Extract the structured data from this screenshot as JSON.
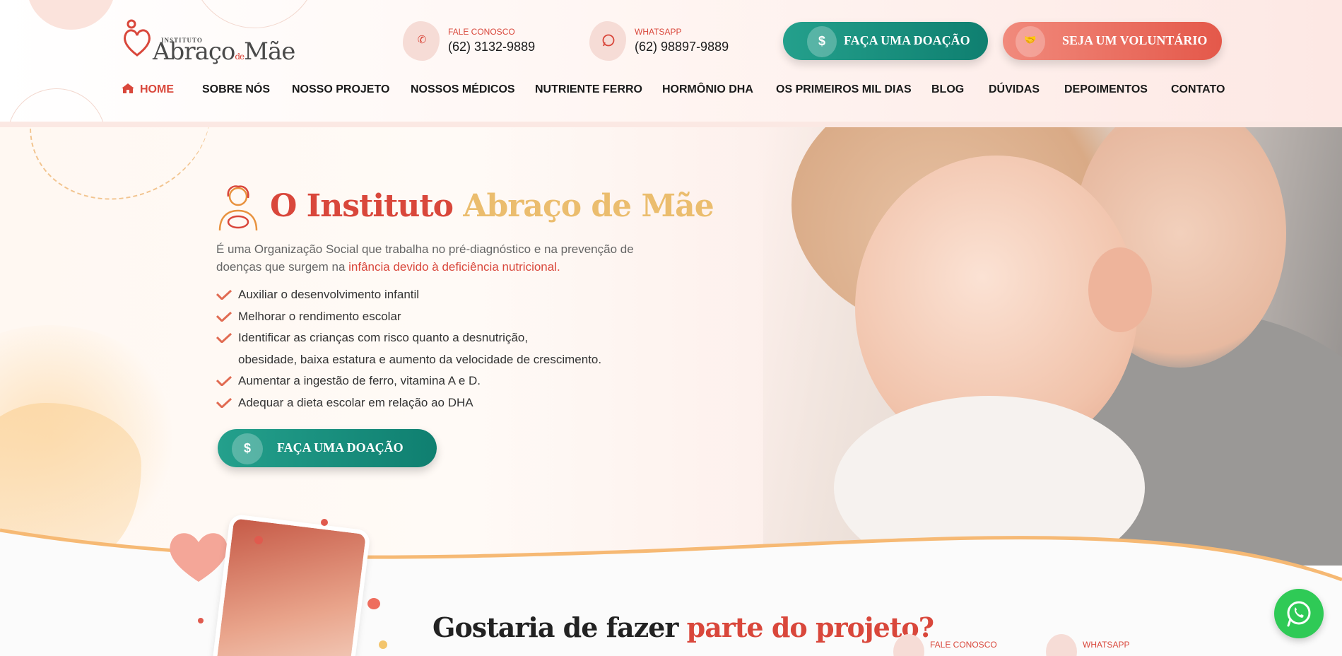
{
  "header": {
    "logo": {
      "instituto": "INSTITUTO",
      "brand_main": "Abraço",
      "brand_de": "de",
      "brand_end": "Mãe"
    },
    "contact_phone": {
      "icon": "phone-icon",
      "label": "FALE CONOSCO",
      "value": "(62) 3132-9889"
    },
    "contact_whatsapp": {
      "icon": "whatsapp-icon",
      "label": "WHATSAPP",
      "value": "(62) 98897-9889"
    },
    "donate_button": {
      "icon": "dollar-icon",
      "label": "FAÇA UMA DOAÇÃO"
    },
    "volunteer_button": {
      "icon": "handshake-icon",
      "label": "SEJA UM VOLUNTÁRIO"
    }
  },
  "nav": {
    "items": [
      {
        "label": "HOME",
        "active": true
      },
      {
        "label": "SOBRE NÓS"
      },
      {
        "label": "NOSSO PROJETO"
      },
      {
        "label": "NOSSOS MÉDICOS"
      },
      {
        "label": "NUTRIENTE FERRO"
      },
      {
        "label": "HORMÔNIO DHA"
      },
      {
        "label": "OS PRIMEIROS MIL DIAS"
      },
      {
        "label": "BLOG"
      },
      {
        "label": "DÚVIDAS"
      },
      {
        "label": "DEPOIMENTOS"
      },
      {
        "label": "CONTATO"
      }
    ]
  },
  "hero": {
    "title_part1": "O Instituto",
    "title_part2": "Abraço de Mãe",
    "description": "É uma Organização Social que trabalha no pré-diagnóstico e na prevenção de doenças que surgem na",
    "description_highlight": "infância devido à deficiência nutricional.",
    "checklist": [
      "Auxiliar o desenvolvimento infantil",
      "Melhorar o rendimento escolar",
      "Identificar as crianças com risco quanto a desnutrição,",
      "Aumentar a ingestão de ferro, vitamina A e D.",
      "Adequar a dieta escolar em relação ao DHA"
    ],
    "checklist_continuation": "obesidade, baixa estatura e aumento da velocidade de crescimento.",
    "cta": {
      "icon": "dollar-icon",
      "label": "FAÇA UMA DOAÇÃO"
    }
  },
  "lower": {
    "title_part1": "Gostaria de fazer",
    "title_part2": "parte do projeto?",
    "contact_phone_label": "FALE CONOSCO",
    "contact_whatsapp_label": "WHATSAPP"
  },
  "floating_whatsapp": {
    "icon": "whatsapp-icon"
  },
  "colors": {
    "brand_red": "#d9473b",
    "brand_gold": "#ebbd6e",
    "teal": "#0f7f70",
    "coral": "#e4584a",
    "whatsapp_green": "#2fca56"
  }
}
